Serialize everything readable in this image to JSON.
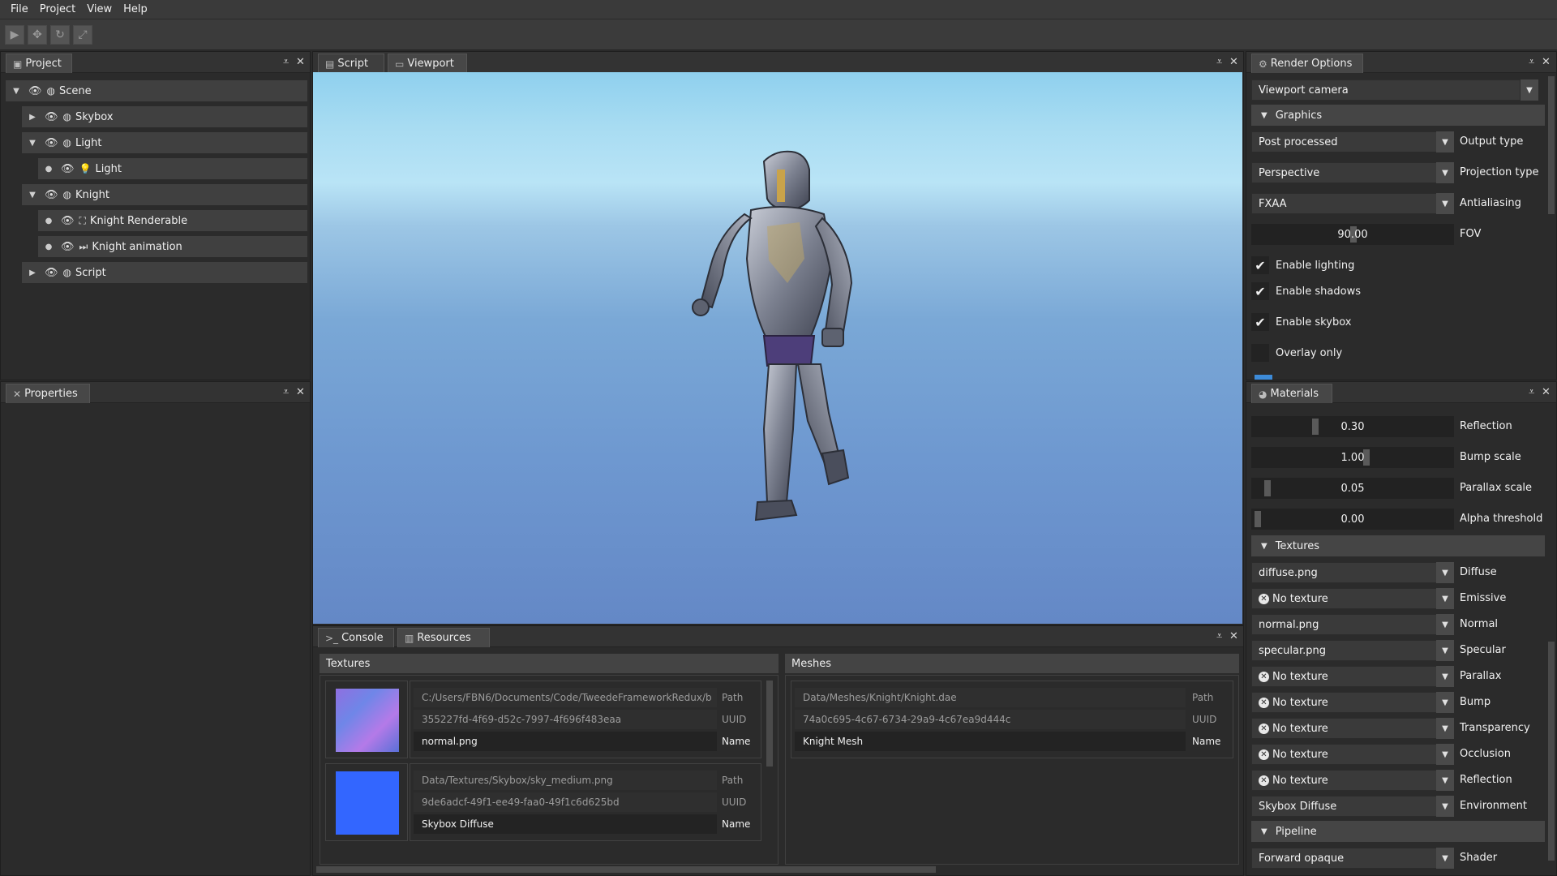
{
  "menubar": [
    "File",
    "Project",
    "View",
    "Help"
  ],
  "toolbar": {
    "play_icon": "play-icon",
    "move_icon": "move-icon",
    "rotate_icon": "rotate-icon",
    "scale_icon": "scale-icon"
  },
  "project_panel": {
    "tab": "Project",
    "tree": [
      {
        "label": "Scene",
        "icon": "scene-node-icon",
        "expanded": true
      },
      {
        "label": "Skybox",
        "icon": "scene-node-icon",
        "expanded": false
      },
      {
        "label": "Light",
        "icon": "scene-node-icon",
        "expanded": true
      },
      {
        "label": "Light",
        "icon": "light-bulb-icon"
      },
      {
        "label": "Knight",
        "icon": "scene-node-icon",
        "expanded": true
      },
      {
        "label": "Knight Renderable",
        "icon": "renderable-icon"
      },
      {
        "label": "Knight animation",
        "icon": "animation-icon"
      },
      {
        "label": "Script",
        "icon": "scene-node-icon",
        "expanded": false
      }
    ]
  },
  "properties_panel": {
    "tab": "Properties"
  },
  "center": {
    "tabs": [
      "Script",
      "Viewport"
    ],
    "active_tab": "Viewport"
  },
  "bottom": {
    "tabs": [
      "Console",
      "Resources"
    ],
    "textures_header": "Textures",
    "meshes_header": "Meshes",
    "textures": [
      {
        "path": "C:/Users/FBN6/Documents/Code/TweedeFrameworkRedux/b",
        "uuid": "355227fd-4f69-d52c-7997-4f696f483eaa",
        "name": "normal.png",
        "thumb_color": "#8f6fe0"
      },
      {
        "path": "Data/Textures/Skybox/sky_medium.png",
        "uuid": "9de6adcf-49f1-ee49-faa0-49f1c6d625bd",
        "name": "Skybox Diffuse",
        "thumb_color": "#3366ff"
      }
    ],
    "meshes": [
      {
        "path": "Data/Meshes/Knight/Knight.dae",
        "uuid": "74a0c695-4c67-6734-29a9-4c67ea9d444c",
        "name": "Knight Mesh"
      }
    ],
    "labels": {
      "path": "Path",
      "uuid": "UUID",
      "name": "Name"
    }
  },
  "render_options": {
    "tab": "Render Options",
    "camera": "Viewport camera",
    "graphics_section": "Graphics",
    "output_type": {
      "value": "Post processed",
      "label": "Output type"
    },
    "projection_type": {
      "value": "Perspective",
      "label": "Projection type"
    },
    "antialiasing": {
      "value": "FXAA",
      "label": "Antialiasing"
    },
    "fov": {
      "value": "90.00",
      "label": "FOV"
    },
    "checks": [
      {
        "label": "Enable lighting",
        "checked": true
      },
      {
        "label": "Enable shadows",
        "checked": true
      },
      {
        "label": "Enable skybox",
        "checked": true
      },
      {
        "label": "Overlay only",
        "checked": false
      }
    ]
  },
  "materials": {
    "tab": "Materials",
    "sliders": [
      {
        "value": "0.30",
        "label": "Reflection",
        "fraction": 0.3
      },
      {
        "value": "1.00",
        "label": "Bump scale",
        "fraction": 0.55
      },
      {
        "value": "0.05",
        "label": "Parallax scale",
        "fraction": 0.05
      },
      {
        "value": "0.00",
        "label": "Alpha threshold",
        "fraction": 0.0
      }
    ],
    "textures_section": "Textures",
    "textures": [
      {
        "value": "diffuse.png",
        "label": "Diffuse",
        "none": false
      },
      {
        "value": "No texture",
        "label": "Emissive",
        "none": true
      },
      {
        "value": "normal.png",
        "label": "Normal",
        "none": false
      },
      {
        "value": "specular.png",
        "label": "Specular",
        "none": false
      },
      {
        "value": "No texture",
        "label": "Parallax",
        "none": true
      },
      {
        "value": "No texture",
        "label": "Bump",
        "none": true
      },
      {
        "value": "No texture",
        "label": "Transparency",
        "none": true
      },
      {
        "value": "No texture",
        "label": "Occlusion",
        "none": true
      },
      {
        "value": "No texture",
        "label": "Reflection",
        "none": true
      },
      {
        "value": "Skybox Diffuse",
        "label": "Environment",
        "none": false
      }
    ],
    "pipeline_section": "Pipeline",
    "shader": {
      "value": "Forward opaque",
      "label": "Shader"
    }
  }
}
